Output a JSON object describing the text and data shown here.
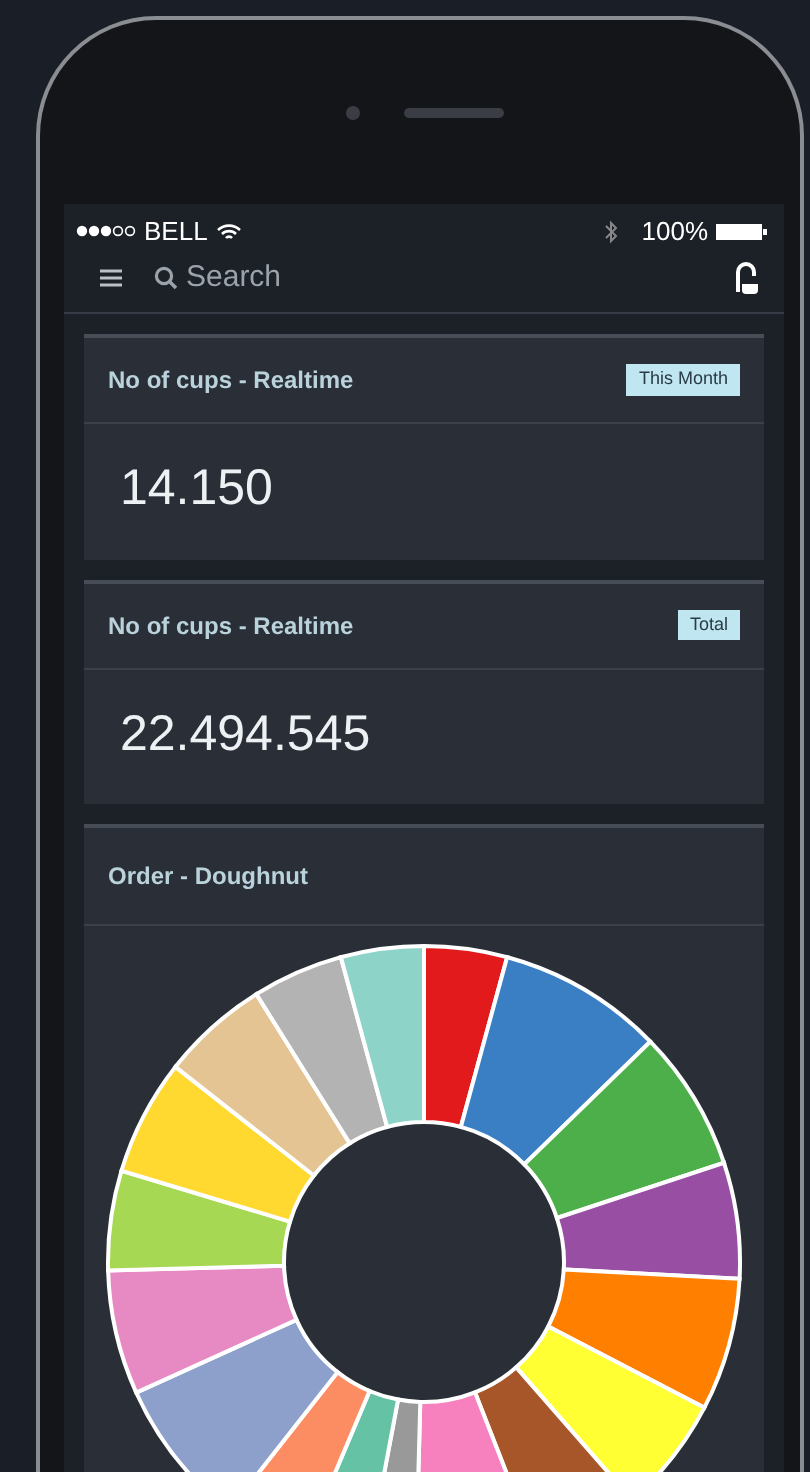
{
  "status_bar": {
    "carrier": "BELL",
    "battery": "100%"
  },
  "search": {
    "placeholder": "Search"
  },
  "cards": [
    {
      "title": "No of cups - Realtime",
      "badge": "This Month",
      "value": "14.150"
    },
    {
      "title": "No of cups - Realtime",
      "badge": "Total",
      "value": "22.494.545"
    }
  ],
  "chart_card": {
    "title": "Order - Doughnut"
  }
}
